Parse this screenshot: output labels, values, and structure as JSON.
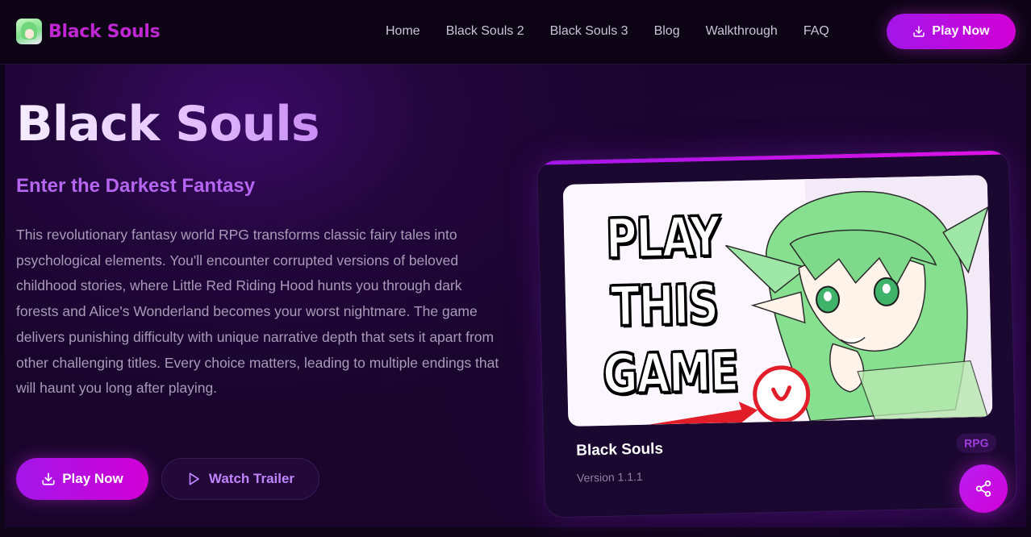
{
  "header": {
    "brand_name": "Black Souls",
    "nav": [
      {
        "label": "Home"
      },
      {
        "label": "Black Souls 2"
      },
      {
        "label": "Black Souls 3"
      },
      {
        "label": "Blog"
      },
      {
        "label": "Walkthrough"
      },
      {
        "label": "FAQ"
      }
    ],
    "cta_label": "Play Now"
  },
  "hero": {
    "title": "Black Souls",
    "subtitle": "Enter the Darkest Fantasy",
    "description": "This revolutionary fantasy world RPG transforms classic fairy tales into psychological elements. You'll encounter corrupted versions of beloved childhood stories, where Little Red Riding Hood hunts you through dark forests and Alice's Wonderland becomes your worst nightmare. The game delivers punishing difficulty with unique narrative depth that sets it apart from other challenging titles. Every choice matters, leading to multiple endings that will haunt you long after playing.",
    "primary_button": "Play Now",
    "secondary_button": "Watch Trailer"
  },
  "card": {
    "image_text": "PLAY THIS GAME",
    "title": "Black Souls",
    "version": "Version 1.1.1",
    "tag": "RPG"
  },
  "icons": {
    "download": "download-icon",
    "play": "play-icon",
    "share": "share-icon"
  },
  "colors": {
    "accent": "#c026d3",
    "accent_gradient_start": "#a316e8",
    "accent_gradient_end": "#d100d6",
    "background": "#0f0518"
  }
}
